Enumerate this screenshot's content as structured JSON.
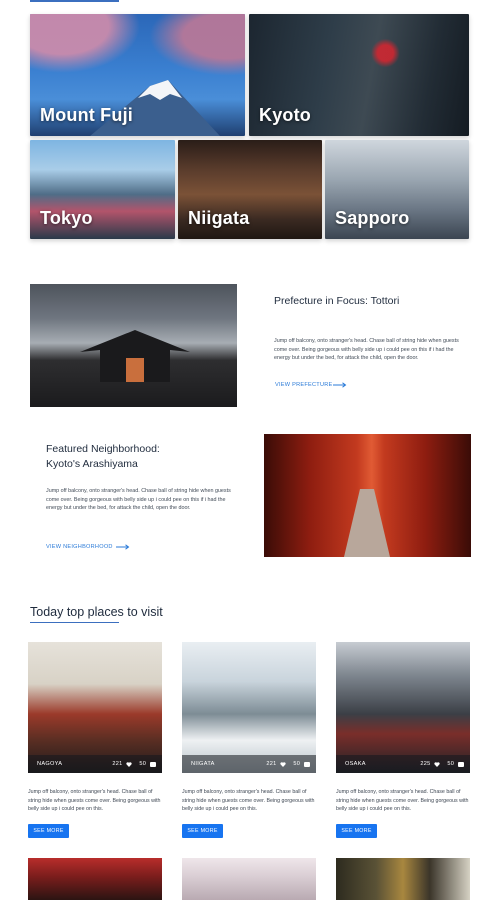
{
  "destinations": [
    {
      "name": "Mount Fuji"
    },
    {
      "name": "Kyoto"
    },
    {
      "name": "Tokyo"
    },
    {
      "name": "Niigata"
    },
    {
      "name": "Sapporo"
    }
  ],
  "prefecture_focus": {
    "title": "Prefecture in Focus: Tottori",
    "body": "Jump off balcony, onto stranger's head. Chase ball of string hide when guests come over. Being gorgeous with belly side up i could pee on this if i had the energy but under the bed, for attack the child, open the door.",
    "link_label": "VIEW PREFECTURE"
  },
  "featured_neighborhood": {
    "title_line1": "Featured Neighborhood:",
    "title_line2": "Kyoto's Arashiyama",
    "body": "Jump off balcony, onto stranger's head. Chase ball of string hide when guests come over. Being gorgeous with belly side up i could pee on this if i had the energy but under the bed, for attack the child, open the door.",
    "link_label": "VIEW NEIGHBORHOOD"
  },
  "top_places": {
    "title": "Today top places to visit",
    "cards": [
      {
        "city": "NAGOYA",
        "likes": "221",
        "comments": "50",
        "text": "Jump off balcony, onto stranger's head. Chase ball of string hide when guests come over. Being gorgeous with belly side up i could pee on this.",
        "button": "SEE MORE"
      },
      {
        "city": "NIIGATA",
        "likes": "221",
        "comments": "50",
        "text": "Jump off balcony, onto stranger's head. Chase ball of string hide when guests come over. Being gorgeous with belly side up i could pee on this.",
        "button": "SEE MORE"
      },
      {
        "city": "OSAKA",
        "likes": "225",
        "comments": "50",
        "text": "Jump off balcony, onto stranger's head. Chase ball of string hide when guests come over. Being gorgeous with belly side up i could pee on this.",
        "button": "SEE MORE"
      }
    ]
  },
  "icons": {
    "like": "heart-icon",
    "comment": "comment-icon",
    "link_arrow": "arrow-right-icon"
  },
  "colors": {
    "accent": "#1774f0",
    "link": "#2b7bd8",
    "title_underline": "#3b6fbf",
    "heading_text": "#1f2b3d"
  }
}
